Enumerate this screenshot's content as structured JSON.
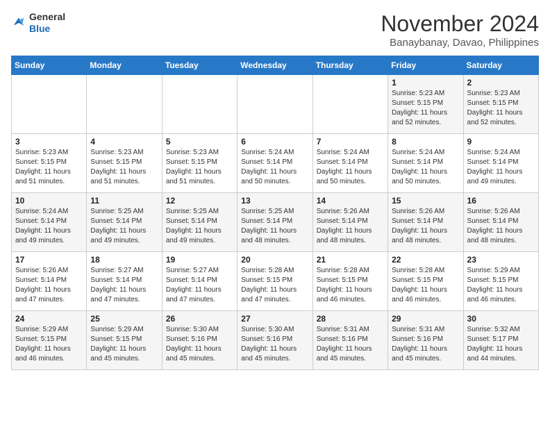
{
  "header": {
    "logo_line1": "General",
    "logo_line2": "Blue",
    "month_title": "November 2024",
    "subtitle": "Banaybanay, Davao, Philippines"
  },
  "days_of_week": [
    "Sunday",
    "Monday",
    "Tuesday",
    "Wednesday",
    "Thursday",
    "Friday",
    "Saturday"
  ],
  "weeks": [
    [
      {
        "day": "",
        "info": ""
      },
      {
        "day": "",
        "info": ""
      },
      {
        "day": "",
        "info": ""
      },
      {
        "day": "",
        "info": ""
      },
      {
        "day": "",
        "info": ""
      },
      {
        "day": "1",
        "info": "Sunrise: 5:23 AM\nSunset: 5:15 PM\nDaylight: 11 hours and 52 minutes."
      },
      {
        "day": "2",
        "info": "Sunrise: 5:23 AM\nSunset: 5:15 PM\nDaylight: 11 hours and 52 minutes."
      }
    ],
    [
      {
        "day": "3",
        "info": "Sunrise: 5:23 AM\nSunset: 5:15 PM\nDaylight: 11 hours and 51 minutes."
      },
      {
        "day": "4",
        "info": "Sunrise: 5:23 AM\nSunset: 5:15 PM\nDaylight: 11 hours and 51 minutes."
      },
      {
        "day": "5",
        "info": "Sunrise: 5:23 AM\nSunset: 5:15 PM\nDaylight: 11 hours and 51 minutes."
      },
      {
        "day": "6",
        "info": "Sunrise: 5:24 AM\nSunset: 5:14 PM\nDaylight: 11 hours and 50 minutes."
      },
      {
        "day": "7",
        "info": "Sunrise: 5:24 AM\nSunset: 5:14 PM\nDaylight: 11 hours and 50 minutes."
      },
      {
        "day": "8",
        "info": "Sunrise: 5:24 AM\nSunset: 5:14 PM\nDaylight: 11 hours and 50 minutes."
      },
      {
        "day": "9",
        "info": "Sunrise: 5:24 AM\nSunset: 5:14 PM\nDaylight: 11 hours and 49 minutes."
      }
    ],
    [
      {
        "day": "10",
        "info": "Sunrise: 5:24 AM\nSunset: 5:14 PM\nDaylight: 11 hours and 49 minutes."
      },
      {
        "day": "11",
        "info": "Sunrise: 5:25 AM\nSunset: 5:14 PM\nDaylight: 11 hours and 49 minutes."
      },
      {
        "day": "12",
        "info": "Sunrise: 5:25 AM\nSunset: 5:14 PM\nDaylight: 11 hours and 49 minutes."
      },
      {
        "day": "13",
        "info": "Sunrise: 5:25 AM\nSunset: 5:14 PM\nDaylight: 11 hours and 48 minutes."
      },
      {
        "day": "14",
        "info": "Sunrise: 5:26 AM\nSunset: 5:14 PM\nDaylight: 11 hours and 48 minutes."
      },
      {
        "day": "15",
        "info": "Sunrise: 5:26 AM\nSunset: 5:14 PM\nDaylight: 11 hours and 48 minutes."
      },
      {
        "day": "16",
        "info": "Sunrise: 5:26 AM\nSunset: 5:14 PM\nDaylight: 11 hours and 48 minutes."
      }
    ],
    [
      {
        "day": "17",
        "info": "Sunrise: 5:26 AM\nSunset: 5:14 PM\nDaylight: 11 hours and 47 minutes."
      },
      {
        "day": "18",
        "info": "Sunrise: 5:27 AM\nSunset: 5:14 PM\nDaylight: 11 hours and 47 minutes."
      },
      {
        "day": "19",
        "info": "Sunrise: 5:27 AM\nSunset: 5:14 PM\nDaylight: 11 hours and 47 minutes."
      },
      {
        "day": "20",
        "info": "Sunrise: 5:28 AM\nSunset: 5:15 PM\nDaylight: 11 hours and 47 minutes."
      },
      {
        "day": "21",
        "info": "Sunrise: 5:28 AM\nSunset: 5:15 PM\nDaylight: 11 hours and 46 minutes."
      },
      {
        "day": "22",
        "info": "Sunrise: 5:28 AM\nSunset: 5:15 PM\nDaylight: 11 hours and 46 minutes."
      },
      {
        "day": "23",
        "info": "Sunrise: 5:29 AM\nSunset: 5:15 PM\nDaylight: 11 hours and 46 minutes."
      }
    ],
    [
      {
        "day": "24",
        "info": "Sunrise: 5:29 AM\nSunset: 5:15 PM\nDaylight: 11 hours and 46 minutes."
      },
      {
        "day": "25",
        "info": "Sunrise: 5:29 AM\nSunset: 5:15 PM\nDaylight: 11 hours and 45 minutes."
      },
      {
        "day": "26",
        "info": "Sunrise: 5:30 AM\nSunset: 5:16 PM\nDaylight: 11 hours and 45 minutes."
      },
      {
        "day": "27",
        "info": "Sunrise: 5:30 AM\nSunset: 5:16 PM\nDaylight: 11 hours and 45 minutes."
      },
      {
        "day": "28",
        "info": "Sunrise: 5:31 AM\nSunset: 5:16 PM\nDaylight: 11 hours and 45 minutes."
      },
      {
        "day": "29",
        "info": "Sunrise: 5:31 AM\nSunset: 5:16 PM\nDaylight: 11 hours and 45 minutes."
      },
      {
        "day": "30",
        "info": "Sunrise: 5:32 AM\nSunset: 5:17 PM\nDaylight: 11 hours and 44 minutes."
      }
    ]
  ]
}
